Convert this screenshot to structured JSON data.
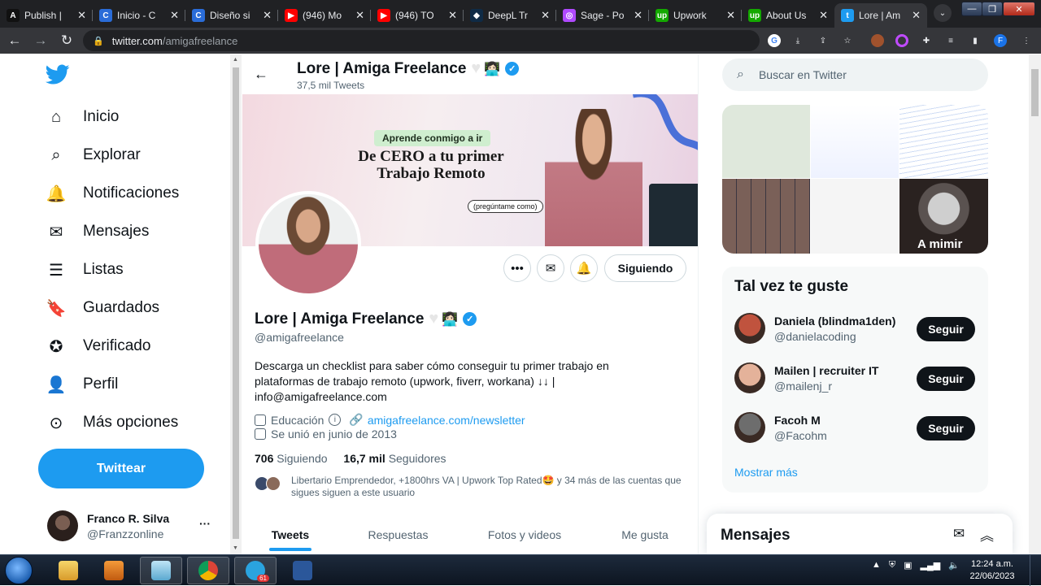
{
  "browser": {
    "tabs": [
      {
        "title": "Publish |",
        "favicon": "A",
        "color": "#111111"
      },
      {
        "title": "Inicio - C",
        "favicon": "C",
        "color": "#2a6cd8"
      },
      {
        "title": "Diseño si",
        "favicon": "C",
        "color": "#2a6cd8"
      },
      {
        "title": "(946) Mo",
        "favicon": "▶",
        "color": "#ff0000"
      },
      {
        "title": "(946) TO",
        "favicon": "▶",
        "color": "#ff0000"
      },
      {
        "title": "DeepL Tr",
        "favicon": "◆",
        "color": "#0f2b46"
      },
      {
        "title": "Sage - Po",
        "favicon": "◎",
        "color": "#b04aff"
      },
      {
        "title": "Upwork",
        "favicon": "up",
        "color": "#14a800"
      },
      {
        "title": "About Us",
        "favicon": "up",
        "color": "#14a800"
      },
      {
        "title": "Lore | Am",
        "favicon": "t",
        "color": "#1d9bf0",
        "active": true
      }
    ],
    "url_domain": "twitter.com",
    "url_path": "/amigafreelance"
  },
  "nav": {
    "items": [
      {
        "label": "Inicio",
        "icon": "home-icon"
      },
      {
        "label": "Explorar",
        "icon": "search-icon"
      },
      {
        "label": "Notificaciones",
        "icon": "bell-icon"
      },
      {
        "label": "Mensajes",
        "icon": "mail-icon"
      },
      {
        "label": "Listas",
        "icon": "list-icon"
      },
      {
        "label": "Guardados",
        "icon": "bookmark-icon"
      },
      {
        "label": "Verificado",
        "icon": "verified-icon"
      },
      {
        "label": "Perfil",
        "icon": "person-icon"
      },
      {
        "label": "Más opciones",
        "icon": "more-circle-icon"
      }
    ],
    "tweet_button": "Twittear",
    "account": {
      "name": "Franco R. Silva",
      "handle": "@Franzzonline"
    }
  },
  "profile": {
    "header_name": "Lore | Amiga Freelance",
    "tweet_count": "37,5 mil Tweets",
    "banner": {
      "pill": "Aprende conmigo a ir",
      "headline": "De CERO a tu primer Trabajo Remoto",
      "tag": "(pregúntame como)"
    },
    "following_button": "Siguiendo",
    "name": "Lore | Amiga Freelance",
    "handle": "@amigafreelance",
    "bio": "Descarga un checklist para saber cómo conseguir tu primer trabajo en plataformas de trabajo remoto (upwork, fiverr, workana) ↓↓ | info@amigafreelance.com",
    "category": "Educación",
    "website": "amigafreelance.com/newsletter",
    "joined": "Se unió en junio de 2013",
    "following_count": "706",
    "following_label": "Siguiendo",
    "followers_count": "16,7 mil",
    "followers_label": "Seguidores",
    "followers_you_know": "Libertario Emprendedor, +1800hrs VA | Upwork Top Rated🤩 y 34 más de las cuentas que sigues siguen a este usuario",
    "tabs": [
      "Tweets",
      "Respuestas",
      "Fotos y videos",
      "Me gusta"
    ]
  },
  "sidebar": {
    "search_placeholder": "Buscar en Twitter",
    "media_caption": "A mimir",
    "who_to_follow_title": "Tal vez te guste",
    "suggestions": [
      {
        "name": "Daniela (blindma1den)",
        "handle": "@danielacoding",
        "button": "Seguir",
        "color": "#c0533e"
      },
      {
        "name": "Mailen | recruiter IT",
        "handle": "@mailenj_r",
        "button": "Seguir",
        "color": "#e4b29a"
      },
      {
        "name": "Facoh M",
        "handle": "@Facohm",
        "button": "Seguir",
        "color": "#6d6d6d"
      }
    ],
    "show_more": "Mostrar más",
    "messages_title": "Mensajes"
  },
  "taskbar": {
    "telegram_badge": "61",
    "time": "12:24 a.m.",
    "date": "22/06/2023"
  },
  "colors": {
    "accent": "#1d9bf0",
    "text": "#0f1419",
    "muted": "#536471"
  }
}
